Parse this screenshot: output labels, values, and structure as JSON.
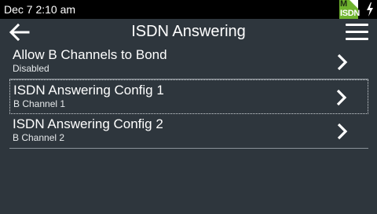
{
  "status_bar": {
    "time": "Dec 7 2:10 am",
    "badge_top": "M",
    "badge_label": "ISDN"
  },
  "header": {
    "title": "ISDN Answering"
  },
  "icons": {
    "back": "arrow-left-icon",
    "menu": "hamburger-menu-icon",
    "chevron": "chevron-right-icon",
    "power": "lightning-bolt-icon"
  },
  "list": {
    "items": [
      {
        "title": "Allow B Channels to Bond",
        "subtitle": "Disabled"
      },
      {
        "title": "ISDN Answering Config 1",
        "subtitle": "B Channel 1"
      },
      {
        "title": "ISDN Answering Config 2",
        "subtitle": "B Channel 2"
      }
    ]
  },
  "colors": {
    "background": "#2e363d",
    "status_bar": "#000000",
    "badge": "#6fb32e",
    "divider": "#8a9198"
  }
}
